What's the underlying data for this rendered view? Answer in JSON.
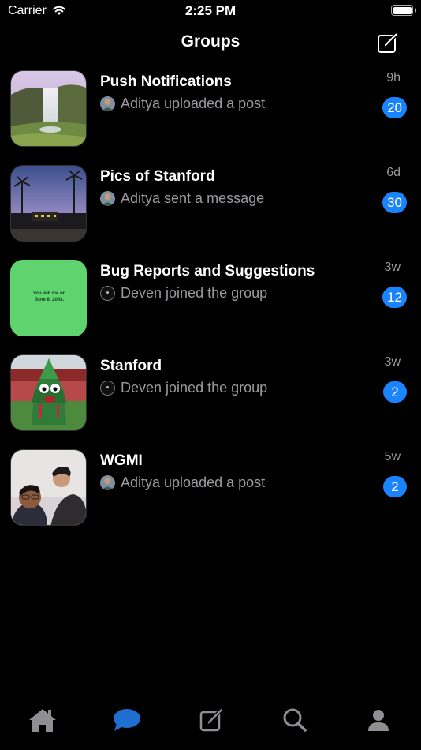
{
  "status_bar": {
    "carrier": "Carrier",
    "time": "2:25 PM"
  },
  "nav": {
    "title": "Groups",
    "compose_icon": "compose-icon"
  },
  "groups": [
    {
      "name": "Push Notifications",
      "subtitle": "Aditya uploaded a post",
      "time": "9h",
      "badge": "20",
      "avatar": "user-photo"
    },
    {
      "name": "Pics of Stanford",
      "subtitle": "Aditya sent a message",
      "time": "6d",
      "badge": "30",
      "avatar": "user-photo"
    },
    {
      "name": "Bug Reports and Suggestions",
      "subtitle": "Deven joined the group",
      "time": "3w",
      "badge": "12",
      "avatar": "default-avatar",
      "thumb_text": "You will die on June 8, 2043."
    },
    {
      "name": "Stanford",
      "subtitle": "Deven joined the group",
      "time": "3w",
      "badge": "2",
      "avatar": "default-avatar"
    },
    {
      "name": "WGMI",
      "subtitle": "Aditya uploaded a post",
      "time": "5w",
      "badge": "2",
      "avatar": "user-photo"
    }
  ],
  "tab_bar": {
    "items": [
      {
        "icon": "home-icon",
        "active": false
      },
      {
        "icon": "chat-bubble-icon",
        "active": true
      },
      {
        "icon": "compose-icon",
        "active": false
      },
      {
        "icon": "search-icon",
        "active": false
      },
      {
        "icon": "profile-icon",
        "active": false
      }
    ]
  },
  "colors": {
    "background": "#000000",
    "accent": "#1a84ff",
    "secondary_text": "#9b9b9f",
    "active_tab": "#1f6fd1",
    "inactive_tab": "#8e8e93"
  }
}
